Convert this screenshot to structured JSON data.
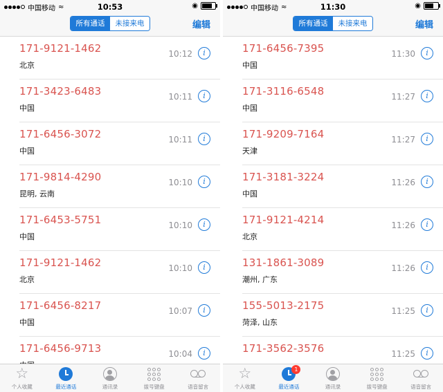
{
  "screens": [
    {
      "status": {
        "carrier": "中国移动",
        "time": "10:53"
      },
      "nav": {
        "seg_all": "所有通话",
        "seg_missed": "未接来电",
        "edit": "编辑"
      },
      "calls": [
        {
          "number": "171-9121-1462",
          "location": "北京",
          "time": "10:12"
        },
        {
          "number": "171-3423-6483",
          "location": "中国",
          "time": "10:11"
        },
        {
          "number": "171-6456-3072",
          "location": "中国",
          "time": "10:11"
        },
        {
          "number": "171-9814-4290",
          "location": "昆明, 云南",
          "time": "10:10"
        },
        {
          "number": "171-6453-5751",
          "location": "中国",
          "time": "10:10"
        },
        {
          "number": "171-9121-1462",
          "location": "北京",
          "time": "10:10"
        },
        {
          "number": "171-6456-8217",
          "location": "中国",
          "time": "10:07"
        },
        {
          "number": "171-6456-9713",
          "location": "中国",
          "time": "10:04"
        }
      ],
      "tabs": {
        "favorites": "个人收藏",
        "recents": "最近通话",
        "contacts": "通讯录",
        "keypad": "拨号键盘",
        "voicemail": "语音留言"
      },
      "badge": ""
    },
    {
      "status": {
        "carrier": "中国移动",
        "time": "11:30"
      },
      "nav": {
        "seg_all": "所有通话",
        "seg_missed": "未接来电",
        "edit": "编辑"
      },
      "calls": [
        {
          "number": "171-6456-7395",
          "location": "中国",
          "time": "11:30"
        },
        {
          "number": "171-3116-6548",
          "location": "中国",
          "time": "11:27"
        },
        {
          "number": "171-9209-7164",
          "location": "天津",
          "time": "11:27"
        },
        {
          "number": "171-3181-3224",
          "location": "中国",
          "time": "11:26"
        },
        {
          "number": "171-9121-4214",
          "location": "北京",
          "time": "11:26"
        },
        {
          "number": "131-1861-3089",
          "location": "潮州, 广东",
          "time": "11:26"
        },
        {
          "number": "155-5013-2175",
          "location": "菏泽, 山东",
          "time": "11:25"
        },
        {
          "number": "171-3562-3576",
          "location": "",
          "time": "11:25"
        }
      ],
      "tabs": {
        "favorites": "个人收藏",
        "recents": "最近通话",
        "contacts": "通讯录",
        "keypad": "拨号键盘",
        "voicemail": "语音留言"
      },
      "badge": "1"
    }
  ],
  "colors": {
    "accent": "#1f7ad8",
    "number": "#d9534f",
    "badge": "#ff3b30"
  },
  "icons": [
    "signal-dots-icon",
    "wifi-icon",
    "alarm-icon",
    "battery-icon",
    "info-icon",
    "star-icon",
    "clock-icon",
    "person-icon",
    "keypad-icon",
    "voicemail-icon"
  ]
}
